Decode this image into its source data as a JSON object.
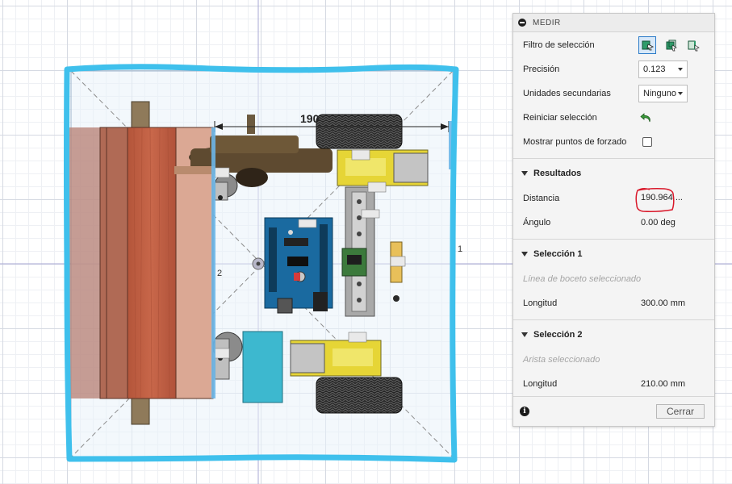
{
  "viewport": {
    "dimension_value": "190",
    "label_2": "2",
    "label_1": "1",
    "highlight_color": "#3fc0ec",
    "annotation_color": "#d9182a"
  },
  "panel": {
    "title": "MEDIR",
    "selection_filter_label": "Filtro de selección",
    "precision_label": "Precisión",
    "precision_value": "0.123",
    "secondary_units_label": "Unidades secundarias",
    "secondary_units_value": "Ninguno",
    "reset_selection_label": "Reiniciar selección",
    "show_snap_points_label": "Mostrar puntos de forzado",
    "results": {
      "title": "Resultados",
      "distance_label": "Distancia",
      "distance_value": "190.964 ...",
      "angle_label": "Ángulo",
      "angle_value": "0.00 deg"
    },
    "selection1": {
      "title": "Selección 1",
      "entity": "Línea de boceto seleccionado",
      "length_label": "Longitud",
      "length_value": "300.00 mm"
    },
    "selection2": {
      "title": "Selección 2",
      "entity": "Arista seleccionado",
      "length_label": "Longitud",
      "length_value": "210.00 mm"
    },
    "close_label": "Cerrar",
    "info_glyph": "i",
    "accent_color": "#2c7bc8"
  }
}
